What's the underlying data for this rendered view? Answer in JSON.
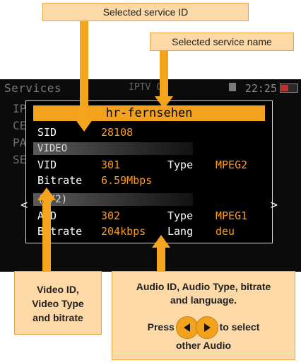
{
  "callouts": {
    "sid": "Selected service ID",
    "name": "Selected service name",
    "video": [
      "Video ID,",
      "Video Type",
      "and bitrate"
    ],
    "audio": {
      "line1": "Audio ID, Audio Type, bitrate",
      "line2": "and language.",
      "press": "Press",
      "to_select": "to select",
      "other_audio": "other Audio"
    }
  },
  "status_bar": {
    "title": "Services",
    "mode": "IPTV C",
    "time": "22:25"
  },
  "background_menu": [
    "IP",
    "CE",
    "PA",
    "SE"
  ],
  "popup": {
    "service_name": "hr-fernsehen",
    "sid_label": "SID",
    "sid_value": "28108",
    "video_section": "VIDEO",
    "vid_label": "VID",
    "vid_value": "301",
    "video_type_label": "Type",
    "video_type_value": "MPEG2",
    "video_bitrate_label": "Bitrate",
    "video_bitrate_value": "6.59Mbps",
    "nav_left": "<",
    "nav_right": ">",
    "audio_section": "(1/2)",
    "aid_label": "AID",
    "aid_value": "302",
    "audio_type_label": "Type",
    "audio_type_value": "MPEG1",
    "audio_bitrate_label": "Bitrate",
    "audio_bitrate_value": "204kbps",
    "lang_label": "Lang",
    "lang_value": "deu"
  }
}
